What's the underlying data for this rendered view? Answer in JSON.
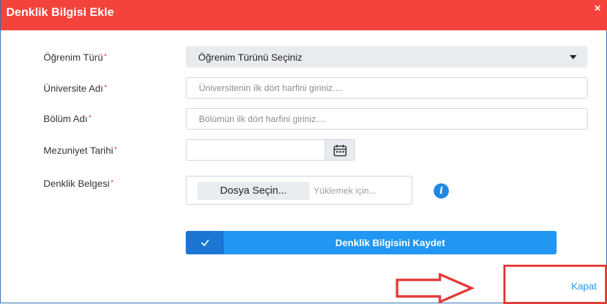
{
  "dialog": {
    "title": "Denklik Bilgisi Ekle",
    "close_glyph": "×"
  },
  "form": {
    "ogrenim_turu": {
      "label": "Öğrenim Türü",
      "required_mark": "•",
      "selected": "Öğrenim Türünü Seçiniz"
    },
    "universite": {
      "label": "Üniversite Adı",
      "required_mark": "•",
      "value": "",
      "placeholder": "Üniversitenin ilk dört harfini giriniz...."
    },
    "bolum": {
      "label": "Bölüm Adı",
      "required_mark": "•",
      "value": "",
      "placeholder": "Bölümün ilk dört harfini giriniz...."
    },
    "mezuniyet": {
      "label": "Mezuniyet Tarihi",
      "required_mark": "•",
      "value": ""
    },
    "belge": {
      "label": "Denklik Belgesi",
      "required_mark": "•",
      "button_label": "Dosya Seçin...",
      "placeholder": "Yüklemek için..."
    }
  },
  "buttons": {
    "save_label": "Denklik Bilgisini Kaydet",
    "close_label": "Kapat"
  },
  "colors": {
    "header": "#f4433c",
    "primary": "#2196f3",
    "annotation": "#e53935"
  },
  "icons": {
    "calendar": "calendar-icon",
    "info": "info-icon",
    "check": "check-icon",
    "caret": "caret-down-icon",
    "arrow": "arrow-right-icon"
  }
}
